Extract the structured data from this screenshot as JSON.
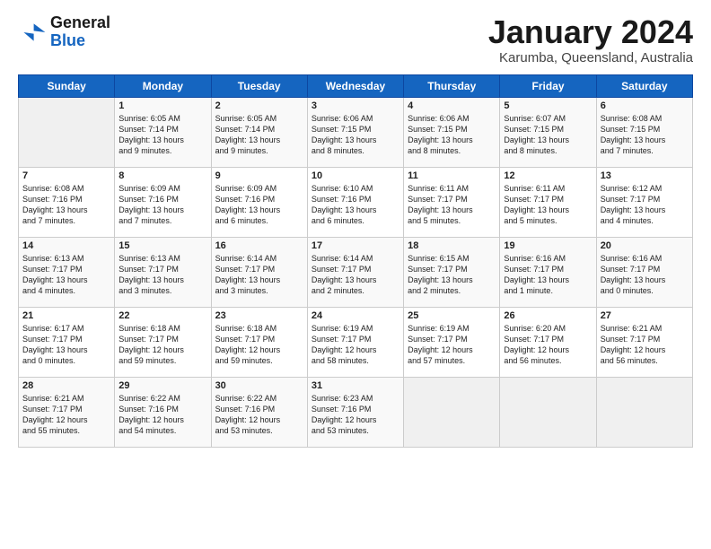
{
  "logo": {
    "line1": "General",
    "line2": "Blue"
  },
  "title": "January 2024",
  "location": "Karumba, Queensland, Australia",
  "headers": [
    "Sunday",
    "Monday",
    "Tuesday",
    "Wednesday",
    "Thursday",
    "Friday",
    "Saturday"
  ],
  "weeks": [
    [
      {
        "date": "",
        "info": ""
      },
      {
        "date": "1",
        "info": "Sunrise: 6:05 AM\nSunset: 7:14 PM\nDaylight: 13 hours\nand 9 minutes."
      },
      {
        "date": "2",
        "info": "Sunrise: 6:05 AM\nSunset: 7:14 PM\nDaylight: 13 hours\nand 9 minutes."
      },
      {
        "date": "3",
        "info": "Sunrise: 6:06 AM\nSunset: 7:15 PM\nDaylight: 13 hours\nand 8 minutes."
      },
      {
        "date": "4",
        "info": "Sunrise: 6:06 AM\nSunset: 7:15 PM\nDaylight: 13 hours\nand 8 minutes."
      },
      {
        "date": "5",
        "info": "Sunrise: 6:07 AM\nSunset: 7:15 PM\nDaylight: 13 hours\nand 8 minutes."
      },
      {
        "date": "6",
        "info": "Sunrise: 6:08 AM\nSunset: 7:15 PM\nDaylight: 13 hours\nand 7 minutes."
      }
    ],
    [
      {
        "date": "7",
        "info": "Sunrise: 6:08 AM\nSunset: 7:16 PM\nDaylight: 13 hours\nand 7 minutes."
      },
      {
        "date": "8",
        "info": "Sunrise: 6:09 AM\nSunset: 7:16 PM\nDaylight: 13 hours\nand 7 minutes."
      },
      {
        "date": "9",
        "info": "Sunrise: 6:09 AM\nSunset: 7:16 PM\nDaylight: 13 hours\nand 6 minutes."
      },
      {
        "date": "10",
        "info": "Sunrise: 6:10 AM\nSunset: 7:16 PM\nDaylight: 13 hours\nand 6 minutes."
      },
      {
        "date": "11",
        "info": "Sunrise: 6:11 AM\nSunset: 7:17 PM\nDaylight: 13 hours\nand 5 minutes."
      },
      {
        "date": "12",
        "info": "Sunrise: 6:11 AM\nSunset: 7:17 PM\nDaylight: 13 hours\nand 5 minutes."
      },
      {
        "date": "13",
        "info": "Sunrise: 6:12 AM\nSunset: 7:17 PM\nDaylight: 13 hours\nand 4 minutes."
      }
    ],
    [
      {
        "date": "14",
        "info": "Sunrise: 6:13 AM\nSunset: 7:17 PM\nDaylight: 13 hours\nand 4 minutes."
      },
      {
        "date": "15",
        "info": "Sunrise: 6:13 AM\nSunset: 7:17 PM\nDaylight: 13 hours\nand 3 minutes."
      },
      {
        "date": "16",
        "info": "Sunrise: 6:14 AM\nSunset: 7:17 PM\nDaylight: 13 hours\nand 3 minutes."
      },
      {
        "date": "17",
        "info": "Sunrise: 6:14 AM\nSunset: 7:17 PM\nDaylight: 13 hours\nand 2 minutes."
      },
      {
        "date": "18",
        "info": "Sunrise: 6:15 AM\nSunset: 7:17 PM\nDaylight: 13 hours\nand 2 minutes."
      },
      {
        "date": "19",
        "info": "Sunrise: 6:16 AM\nSunset: 7:17 PM\nDaylight: 13 hours\nand 1 minute."
      },
      {
        "date": "20",
        "info": "Sunrise: 6:16 AM\nSunset: 7:17 PM\nDaylight: 13 hours\nand 0 minutes."
      }
    ],
    [
      {
        "date": "21",
        "info": "Sunrise: 6:17 AM\nSunset: 7:17 PM\nDaylight: 13 hours\nand 0 minutes."
      },
      {
        "date": "22",
        "info": "Sunrise: 6:18 AM\nSunset: 7:17 PM\nDaylight: 12 hours\nand 59 minutes."
      },
      {
        "date": "23",
        "info": "Sunrise: 6:18 AM\nSunset: 7:17 PM\nDaylight: 12 hours\nand 59 minutes."
      },
      {
        "date": "24",
        "info": "Sunrise: 6:19 AM\nSunset: 7:17 PM\nDaylight: 12 hours\nand 58 minutes."
      },
      {
        "date": "25",
        "info": "Sunrise: 6:19 AM\nSunset: 7:17 PM\nDaylight: 12 hours\nand 57 minutes."
      },
      {
        "date": "26",
        "info": "Sunrise: 6:20 AM\nSunset: 7:17 PM\nDaylight: 12 hours\nand 56 minutes."
      },
      {
        "date": "27",
        "info": "Sunrise: 6:21 AM\nSunset: 7:17 PM\nDaylight: 12 hours\nand 56 minutes."
      }
    ],
    [
      {
        "date": "28",
        "info": "Sunrise: 6:21 AM\nSunset: 7:17 PM\nDaylight: 12 hours\nand 55 minutes."
      },
      {
        "date": "29",
        "info": "Sunrise: 6:22 AM\nSunset: 7:16 PM\nDaylight: 12 hours\nand 54 minutes."
      },
      {
        "date": "30",
        "info": "Sunrise: 6:22 AM\nSunset: 7:16 PM\nDaylight: 12 hours\nand 53 minutes."
      },
      {
        "date": "31",
        "info": "Sunrise: 6:23 AM\nSunset: 7:16 PM\nDaylight: 12 hours\nand 53 minutes."
      },
      {
        "date": "",
        "info": ""
      },
      {
        "date": "",
        "info": ""
      },
      {
        "date": "",
        "info": ""
      }
    ]
  ]
}
